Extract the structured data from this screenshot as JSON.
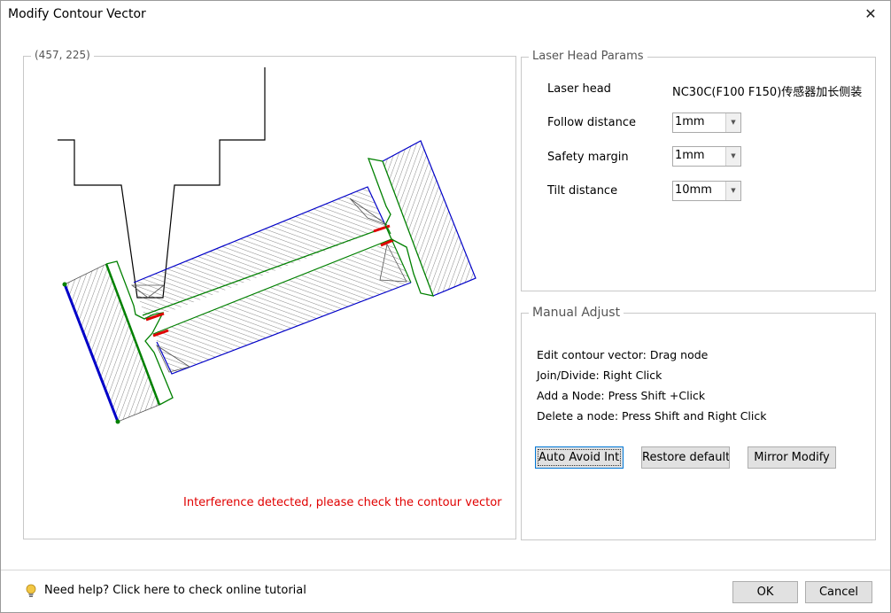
{
  "window": {
    "title": "Modify Contour Vector",
    "close_symbol": "✕"
  },
  "canvas": {
    "coordinate_readout": "(457, 225)",
    "warning": "Interference detected, please check the contour vector",
    "colors": {
      "outline": "#000000",
      "contour_blue": "#0000c8",
      "contour_green": "#008000",
      "interference": "#e00000"
    }
  },
  "laser_head_params": {
    "title": "Laser Head Params",
    "laser_head": {
      "label": "Laser head",
      "value": "NC30C(F100 F150)传感器加长侧装"
    },
    "follow_distance": {
      "label": "Follow distance",
      "value": "1mm"
    },
    "safety_margin": {
      "label": "Safety margin",
      "value": "1mm"
    },
    "tilt_distance": {
      "label": "Tilt distance",
      "value": "10mm"
    }
  },
  "manual_adjust": {
    "title": "Manual Adjust",
    "instructions": [
      "Edit contour vector: Drag node",
      "Join/Divide: Right Click",
      "Add a Node: Press Shift +Click",
      "Delete a node: Press Shift and Right Click"
    ],
    "buttons": {
      "auto_avoid": "Auto Avoid Interference",
      "restore_default": "Restore default",
      "mirror_modify": "Mirror Modify"
    }
  },
  "footer": {
    "help_text": "Need help? Click here to check online tutorial",
    "ok": "OK",
    "cancel": "Cancel"
  }
}
